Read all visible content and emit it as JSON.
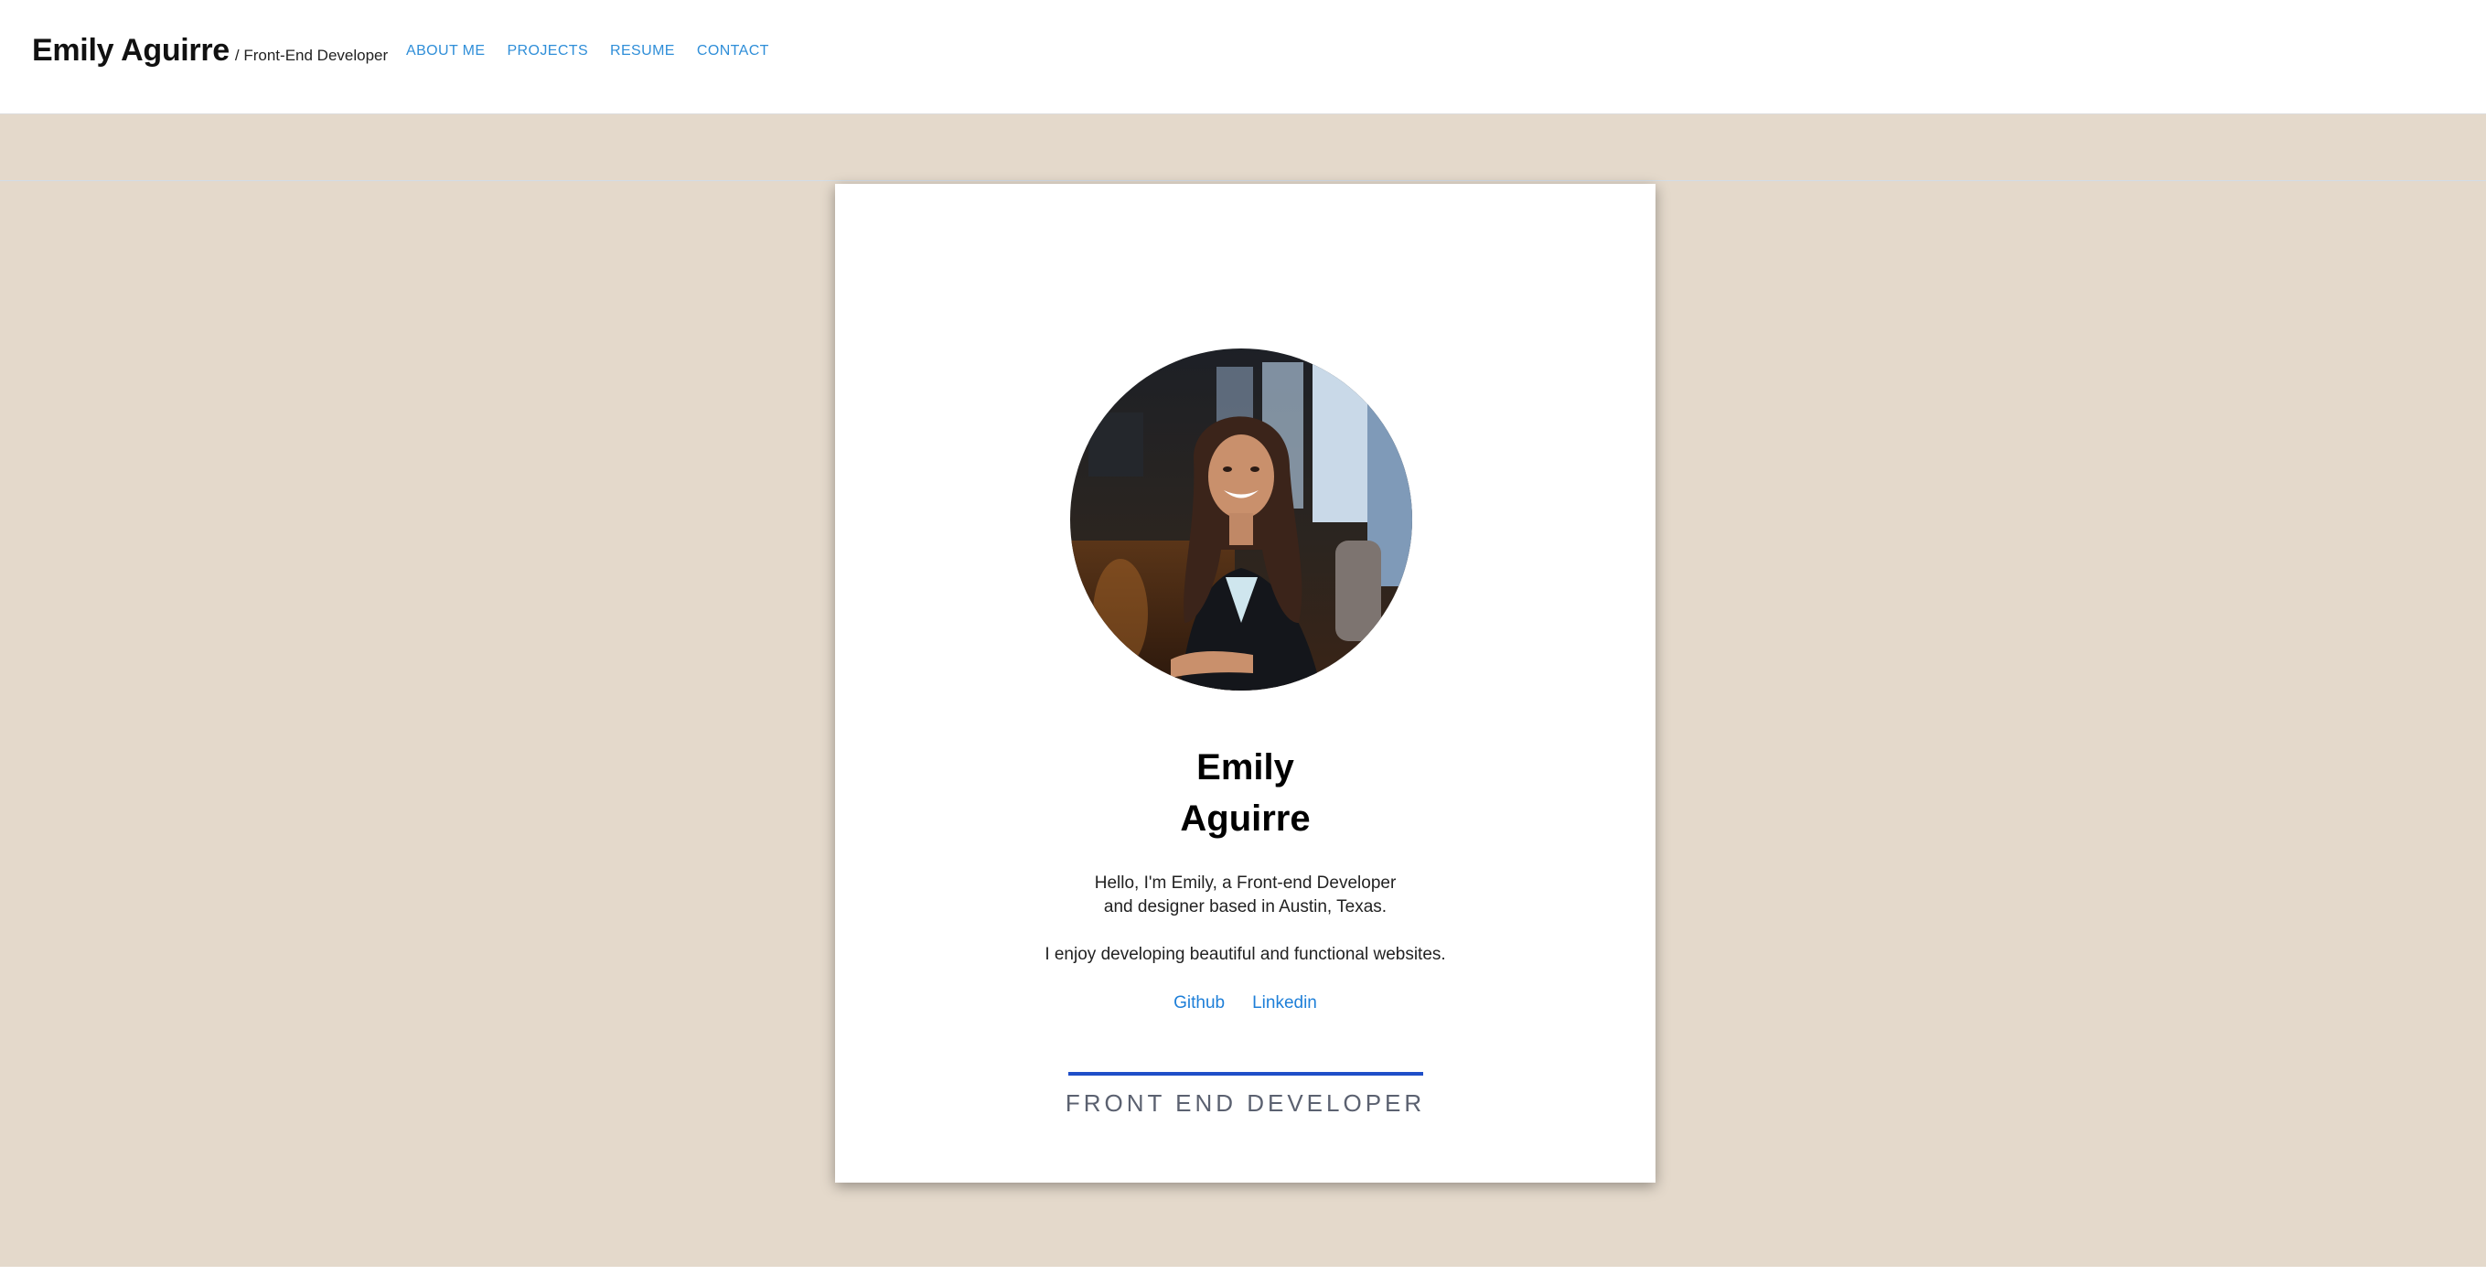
{
  "header": {
    "brand_name": "Emily Aguirre",
    "brand_subtitle": "/ Front-End Developer",
    "nav": [
      {
        "label": "ABOUT ME"
      },
      {
        "label": "PROJECTS"
      },
      {
        "label": "RESUME"
      },
      {
        "label": "CONTACT"
      }
    ]
  },
  "profile": {
    "first_name": "Emily",
    "last_name": "Aguirre",
    "bio_line1": "Hello, I'm Emily, a Front-end Developer",
    "bio_line2": "and designer based in Austin, Texas.",
    "bio_line3": "I enjoy developing beautiful and functional websites.",
    "links": [
      {
        "label": "Github"
      },
      {
        "label": "Linkedin"
      }
    ],
    "role": "FRONT END DEVELOPER"
  },
  "colors": {
    "background": "#e4d9cb",
    "link": "#2f8ed8",
    "accent_bar": "#1f4fc8",
    "role_text": "#5b6170"
  }
}
